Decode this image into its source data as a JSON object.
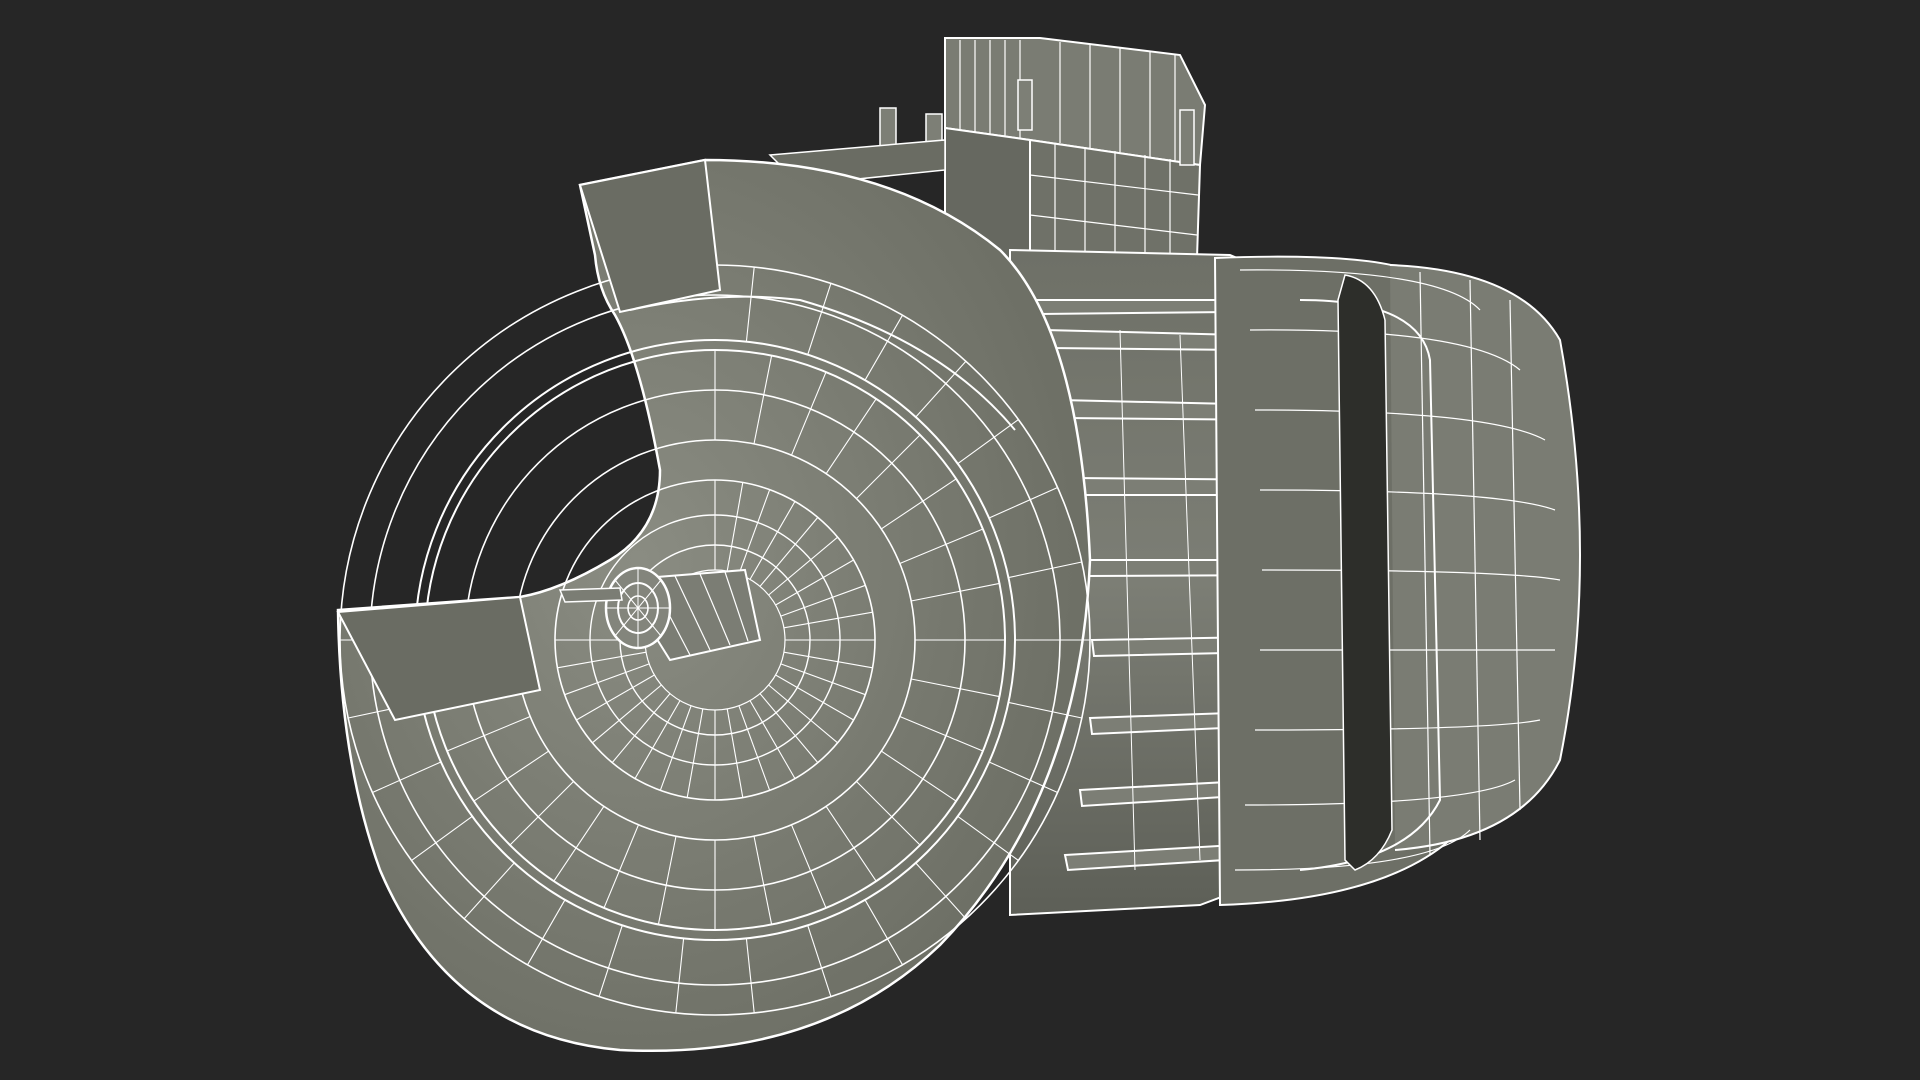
{
  "scene": {
    "background": "#262626",
    "subject": "electric-motor-wireframe",
    "render_style": "wireframe-on-shaded",
    "colors": {
      "surface": "#74766b",
      "surface_light": "#80827a",
      "surface_dark": "#5e6058",
      "wire": "#ffffff",
      "shadow": "#1f201d"
    }
  }
}
